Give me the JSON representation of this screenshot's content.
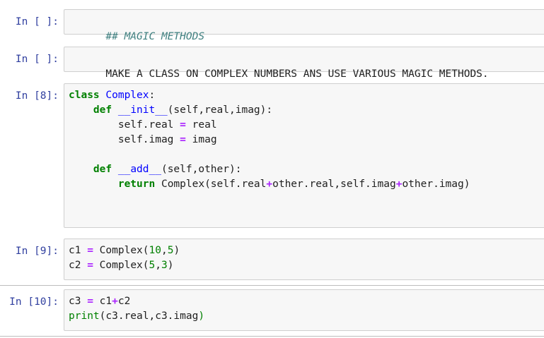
{
  "cells": [
    {
      "prompt": "In [ ]:",
      "lines": [
        "## MAGIC METHODS"
      ]
    },
    {
      "prompt": "In [ ]:",
      "lines": [
        "MAKE A CLASS ON COMPLEX NUMBERS ANS USE VARIOUS MAGIC METHODS."
      ]
    },
    {
      "prompt": "In [8]:",
      "tokens": {
        "kw_class": "class",
        "class_name": "Complex",
        "colon": ":",
        "kw_def": "def",
        "init_name": "__init__",
        "init_args": "(self,real,imag):",
        "self_real": "self.real",
        "assign": "=",
        "real": "real",
        "self_imag": "self.imag",
        "imag": "imag",
        "add_name": "__add__",
        "add_args": "(self,other):",
        "kw_return": "return",
        "ret_call": "Complex(self.real",
        "plus": "+",
        "ret_mid": "other.real,self.imag",
        "ret_end": "other.imag)"
      }
    },
    {
      "prompt": "In [9]:",
      "tokens": {
        "c1": "c1",
        "c2": "c2",
        "assign": "=",
        "complex": "Complex",
        "open": "(",
        "n10": "10",
        "n5": "5",
        "n3": "3",
        "comma": ",",
        "close": ")"
      }
    },
    {
      "prompt": "In [10]:",
      "tokens": {
        "c3": "c3",
        "assign": "=",
        "c1": "c1",
        "plus": "+",
        "c2": "c2",
        "print": "print",
        "print_args": "(c3.real,c3.imag",
        "close": ")"
      }
    }
  ]
}
